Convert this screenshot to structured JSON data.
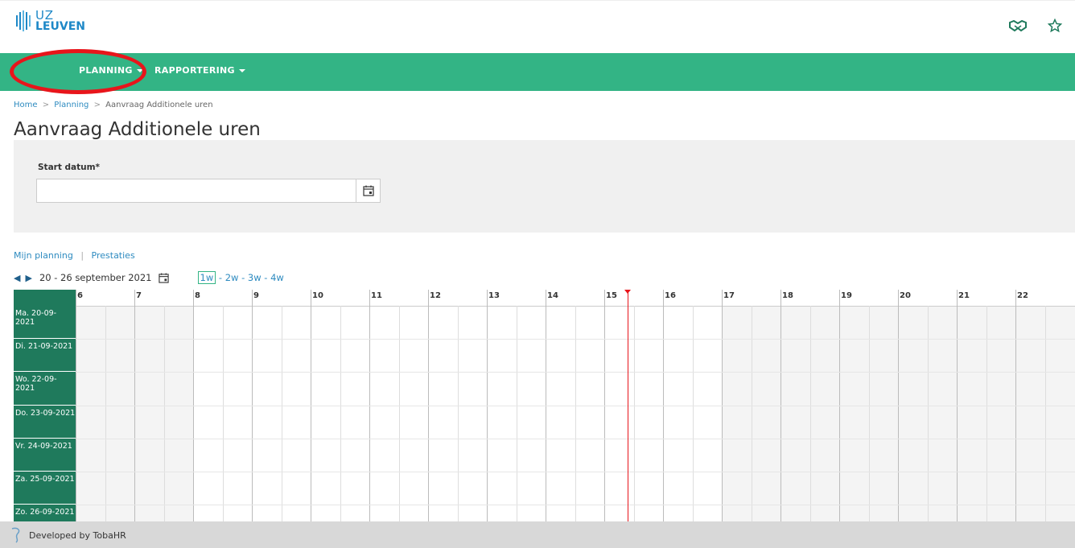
{
  "brand": {
    "line1": "UZ",
    "line2": "LEUVEN",
    "color": "#1e88c7"
  },
  "header_icons": [
    "handshake-icon",
    "star-icon"
  ],
  "nav": {
    "items": [
      {
        "label": "PLANNING",
        "has_dropdown": true
      },
      {
        "label": "RAPPORTERING",
        "has_dropdown": true
      }
    ],
    "color": "#33b485"
  },
  "breadcrumb": {
    "home": "Home",
    "planning": "Planning",
    "current": "Aanvraag Additionele uren",
    "separator": ">"
  },
  "page": {
    "title": "Aanvraag Additionele uren"
  },
  "form": {
    "start_label": "Start datum*",
    "start_value": ""
  },
  "subnav": {
    "mijn_planning": "Mijn planning",
    "separator": "|",
    "prestaties": "Prestaties"
  },
  "week": {
    "range": "20 - 26 september 2021",
    "options": [
      "1w",
      "2w",
      "3w",
      "4w"
    ],
    "active": "1w",
    "option_separator": " - "
  },
  "schedule": {
    "hours": [
      "6",
      "7",
      "8",
      "9",
      "10",
      "11",
      "12",
      "13",
      "14",
      "15",
      "16",
      "17",
      "18",
      "19",
      "20",
      "21",
      "22"
    ],
    "days": [
      "Ma. 20-09-2021",
      "Di. 21-09-2021",
      "Wo. 22-09-2021",
      "Do. 23-09-2021",
      "Vr. 24-09-2021",
      "Za. 25-09-2021",
      "Zo. 26-09-2021"
    ],
    "current_time_hour": 15.4,
    "working_hours": [
      8,
      17
    ],
    "daycolumn_color": "#1f7a5c",
    "now_color": "#e8151b"
  },
  "footer": {
    "text": "Developed by TobaHR"
  }
}
